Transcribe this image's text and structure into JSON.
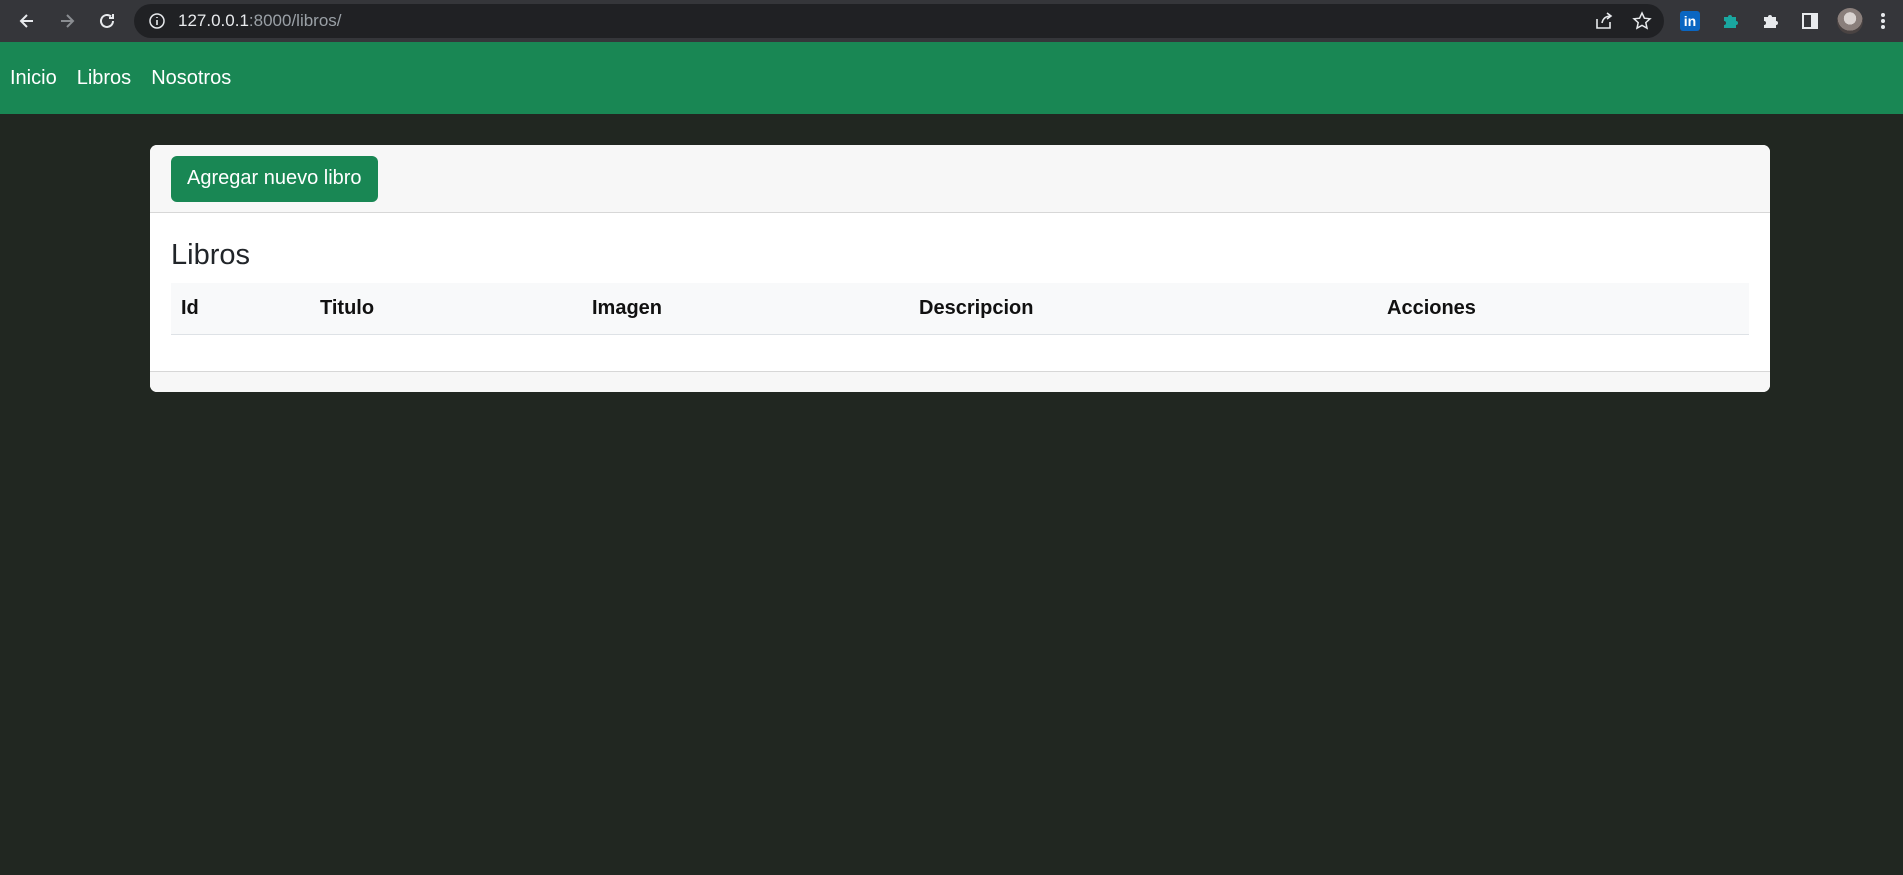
{
  "browser": {
    "url_host": "127.0.0.1",
    "url_path": ":8000/libros/",
    "extensions": [
      "linkedin-icon",
      "puzzle-colored-icon",
      "extensions-icon",
      "side-panel-icon"
    ]
  },
  "navbar": {
    "links": [
      {
        "label": "Inicio"
      },
      {
        "label": "Libros"
      },
      {
        "label": "Nosotros"
      }
    ],
    "color": "#198754"
  },
  "card": {
    "add_button_label": "Agregar nuevo libro",
    "title": "Libros",
    "table": {
      "columns": [
        "Id",
        "Titulo",
        "Imagen",
        "Descripcion",
        "Acciones"
      ],
      "rows": []
    }
  },
  "colors": {
    "page_background": "#212721",
    "accent": "#198754"
  }
}
